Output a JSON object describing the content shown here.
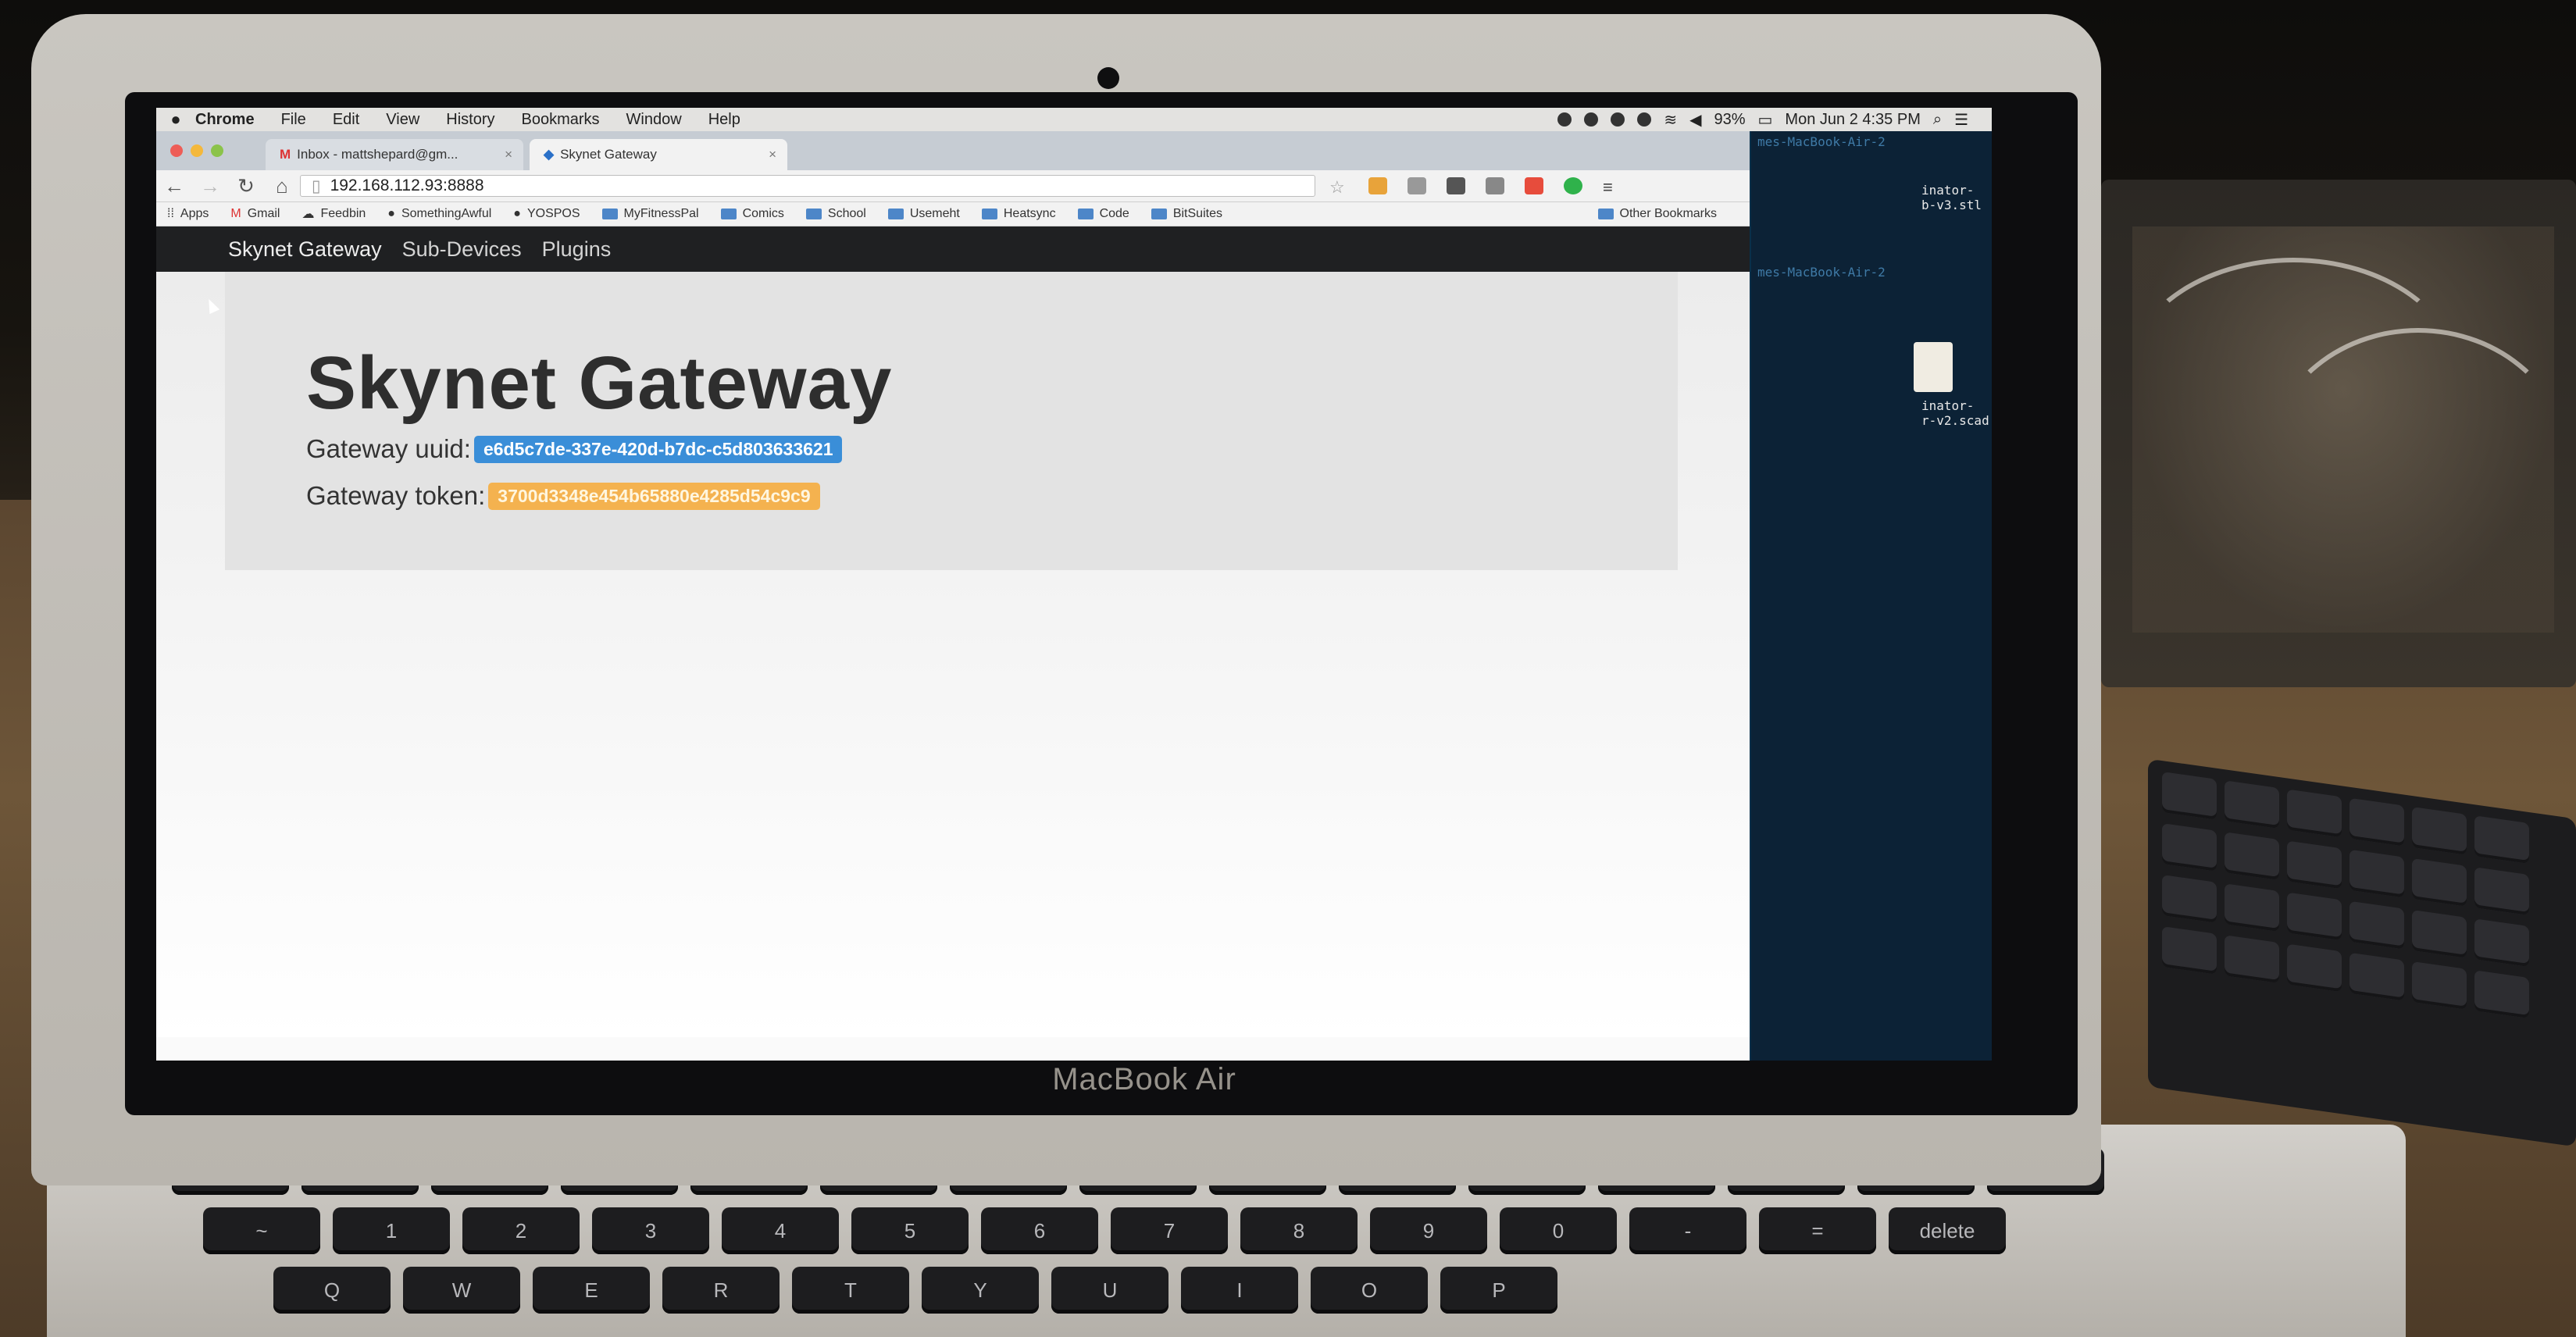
{
  "menubar": {
    "app_name": "Chrome",
    "menus": [
      "File",
      "Edit",
      "View",
      "History",
      "Bookmarks",
      "Window",
      "Help"
    ],
    "battery": "93%",
    "datetime": "Mon Jun 2  4:35 PM"
  },
  "browser": {
    "tabs": [
      {
        "title": "Inbox - mattshepard@gm...",
        "close": "×"
      },
      {
        "title": "Skynet Gateway",
        "close": "×"
      }
    ],
    "address": "192.168.112.93:8888",
    "bookmarks": [
      {
        "label": "Apps"
      },
      {
        "label": "Gmail"
      },
      {
        "label": "Feedbin"
      },
      {
        "label": "SomethingAwful"
      },
      {
        "label": "YOSPOS"
      },
      {
        "label": "MyFitnessPal"
      },
      {
        "label": "Comics"
      },
      {
        "label": "School"
      },
      {
        "label": "Usemeht"
      },
      {
        "label": "Heatsync"
      },
      {
        "label": "Code"
      },
      {
        "label": "BitSuites"
      }
    ],
    "other_bookmarks": "Other Bookmarks"
  },
  "page": {
    "nav": {
      "brand": "Skynet Gateway",
      "links": [
        "Sub-Devices",
        "Plugins"
      ]
    },
    "heading": "Skynet Gateway",
    "uuid_label": "Gateway uuid:",
    "uuid_value": "e6d5c7de-337e-420d-b7dc-c5d803633621",
    "token_label": "Gateway token:",
    "token_value": "3700d3348e454b65880e4285d54c9c9"
  },
  "desktop": {
    "terminal_lines": [
      "mes-MacBook-Air-2",
      "mes-MacBook-Air-2"
    ],
    "files": [
      "inator-\nb-v3.stl",
      "inator-\nr-v2.scad"
    ]
  },
  "hardware": {
    "brand": "MacBook Air"
  },
  "colors": {
    "uuid_badge": "#3a8ed8",
    "token_badge": "#f4b24f",
    "navbar": "#1f2022"
  }
}
